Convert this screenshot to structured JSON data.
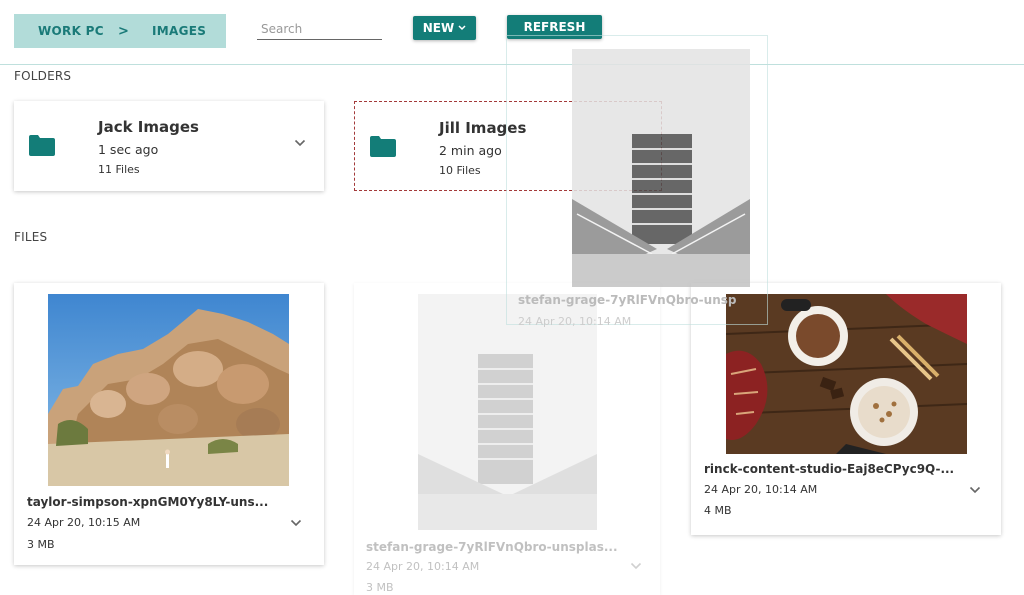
{
  "breadcrumb": {
    "root": "WORK PC",
    "separator": ">",
    "current": "IMAGES"
  },
  "search": {
    "placeholder": "Search",
    "value": ""
  },
  "toolbar": {
    "new_label": "NEW",
    "refresh_label": "REFRESH"
  },
  "sections": {
    "folders": "FOLDERS",
    "files": "FILES"
  },
  "folders": [
    {
      "name": "Jack Images",
      "modified": "1 sec ago",
      "count": "11 Files"
    },
    {
      "name": "Jill Images",
      "modified": "2 min ago",
      "count": "10 Files"
    }
  ],
  "files": [
    {
      "name": "taylor-simpson-xpnGM0Yy8LY-uns...",
      "date": "24 Apr 20, 10:15 AM",
      "size": "3 MB"
    },
    {
      "name": "stefan-grage-7yRlFVnQbro-unsplas...",
      "date": "24 Apr 20, 10:14 AM",
      "size": "3 MB"
    },
    {
      "name": "rinck-content-studio-Eaj8eCPyc9Q-...",
      "date": "24 Apr 20, 10:14 AM",
      "size": "4 MB"
    }
  ],
  "drag_ghost": {
    "name": "stefan-grage-7yRlFVnQbro-unsp",
    "date": "24 Apr 20, 10:14 AM"
  },
  "colors": {
    "accent": "#137d78",
    "breadcrumb_bg": "#b2dcd9",
    "folder": "#137d78",
    "drop_target_border": "#a33a3a"
  },
  "icons": {
    "folder": "folder-icon",
    "chevron": "chevron-down-icon"
  }
}
